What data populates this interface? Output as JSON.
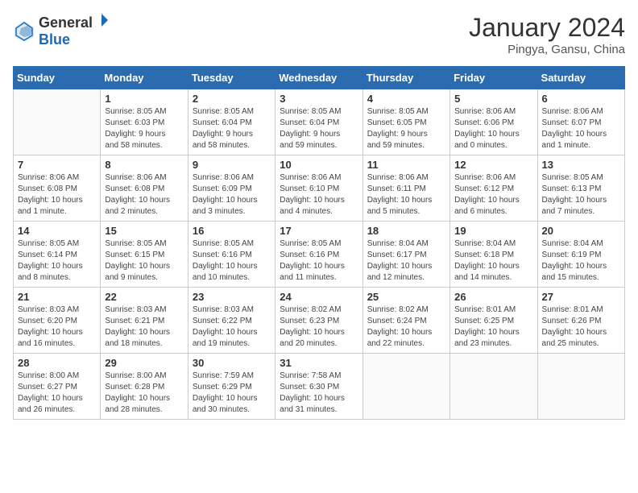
{
  "logo": {
    "general": "General",
    "blue": "Blue"
  },
  "title": "January 2024",
  "subtitle": "Pingya, Gansu, China",
  "days_of_week": [
    "Sunday",
    "Monday",
    "Tuesday",
    "Wednesday",
    "Thursday",
    "Friday",
    "Saturday"
  ],
  "weeks": [
    [
      {
        "day": "",
        "info": ""
      },
      {
        "day": "1",
        "info": "Sunrise: 8:05 AM\nSunset: 6:03 PM\nDaylight: 9 hours\nand 58 minutes."
      },
      {
        "day": "2",
        "info": "Sunrise: 8:05 AM\nSunset: 6:04 PM\nDaylight: 9 hours\nand 58 minutes."
      },
      {
        "day": "3",
        "info": "Sunrise: 8:05 AM\nSunset: 6:04 PM\nDaylight: 9 hours\nand 59 minutes."
      },
      {
        "day": "4",
        "info": "Sunrise: 8:05 AM\nSunset: 6:05 PM\nDaylight: 9 hours\nand 59 minutes."
      },
      {
        "day": "5",
        "info": "Sunrise: 8:06 AM\nSunset: 6:06 PM\nDaylight: 10 hours\nand 0 minutes."
      },
      {
        "day": "6",
        "info": "Sunrise: 8:06 AM\nSunset: 6:07 PM\nDaylight: 10 hours\nand 1 minute."
      }
    ],
    [
      {
        "day": "7",
        "info": "Sunrise: 8:06 AM\nSunset: 6:08 PM\nDaylight: 10 hours\nand 1 minute."
      },
      {
        "day": "8",
        "info": "Sunrise: 8:06 AM\nSunset: 6:08 PM\nDaylight: 10 hours\nand 2 minutes."
      },
      {
        "day": "9",
        "info": "Sunrise: 8:06 AM\nSunset: 6:09 PM\nDaylight: 10 hours\nand 3 minutes."
      },
      {
        "day": "10",
        "info": "Sunrise: 8:06 AM\nSunset: 6:10 PM\nDaylight: 10 hours\nand 4 minutes."
      },
      {
        "day": "11",
        "info": "Sunrise: 8:06 AM\nSunset: 6:11 PM\nDaylight: 10 hours\nand 5 minutes."
      },
      {
        "day": "12",
        "info": "Sunrise: 8:06 AM\nSunset: 6:12 PM\nDaylight: 10 hours\nand 6 minutes."
      },
      {
        "day": "13",
        "info": "Sunrise: 8:05 AM\nSunset: 6:13 PM\nDaylight: 10 hours\nand 7 minutes."
      }
    ],
    [
      {
        "day": "14",
        "info": "Sunrise: 8:05 AM\nSunset: 6:14 PM\nDaylight: 10 hours\nand 8 minutes."
      },
      {
        "day": "15",
        "info": "Sunrise: 8:05 AM\nSunset: 6:15 PM\nDaylight: 10 hours\nand 9 minutes."
      },
      {
        "day": "16",
        "info": "Sunrise: 8:05 AM\nSunset: 6:16 PM\nDaylight: 10 hours\nand 10 minutes."
      },
      {
        "day": "17",
        "info": "Sunrise: 8:05 AM\nSunset: 6:16 PM\nDaylight: 10 hours\nand 11 minutes."
      },
      {
        "day": "18",
        "info": "Sunrise: 8:04 AM\nSunset: 6:17 PM\nDaylight: 10 hours\nand 12 minutes."
      },
      {
        "day": "19",
        "info": "Sunrise: 8:04 AM\nSunset: 6:18 PM\nDaylight: 10 hours\nand 14 minutes."
      },
      {
        "day": "20",
        "info": "Sunrise: 8:04 AM\nSunset: 6:19 PM\nDaylight: 10 hours\nand 15 minutes."
      }
    ],
    [
      {
        "day": "21",
        "info": "Sunrise: 8:03 AM\nSunset: 6:20 PM\nDaylight: 10 hours\nand 16 minutes."
      },
      {
        "day": "22",
        "info": "Sunrise: 8:03 AM\nSunset: 6:21 PM\nDaylight: 10 hours\nand 18 minutes."
      },
      {
        "day": "23",
        "info": "Sunrise: 8:03 AM\nSunset: 6:22 PM\nDaylight: 10 hours\nand 19 minutes."
      },
      {
        "day": "24",
        "info": "Sunrise: 8:02 AM\nSunset: 6:23 PM\nDaylight: 10 hours\nand 20 minutes."
      },
      {
        "day": "25",
        "info": "Sunrise: 8:02 AM\nSunset: 6:24 PM\nDaylight: 10 hours\nand 22 minutes."
      },
      {
        "day": "26",
        "info": "Sunrise: 8:01 AM\nSunset: 6:25 PM\nDaylight: 10 hours\nand 23 minutes."
      },
      {
        "day": "27",
        "info": "Sunrise: 8:01 AM\nSunset: 6:26 PM\nDaylight: 10 hours\nand 25 minutes."
      }
    ],
    [
      {
        "day": "28",
        "info": "Sunrise: 8:00 AM\nSunset: 6:27 PM\nDaylight: 10 hours\nand 26 minutes."
      },
      {
        "day": "29",
        "info": "Sunrise: 8:00 AM\nSunset: 6:28 PM\nDaylight: 10 hours\nand 28 minutes."
      },
      {
        "day": "30",
        "info": "Sunrise: 7:59 AM\nSunset: 6:29 PM\nDaylight: 10 hours\nand 30 minutes."
      },
      {
        "day": "31",
        "info": "Sunrise: 7:58 AM\nSunset: 6:30 PM\nDaylight: 10 hours\nand 31 minutes."
      },
      {
        "day": "",
        "info": ""
      },
      {
        "day": "",
        "info": ""
      },
      {
        "day": "",
        "info": ""
      }
    ]
  ]
}
